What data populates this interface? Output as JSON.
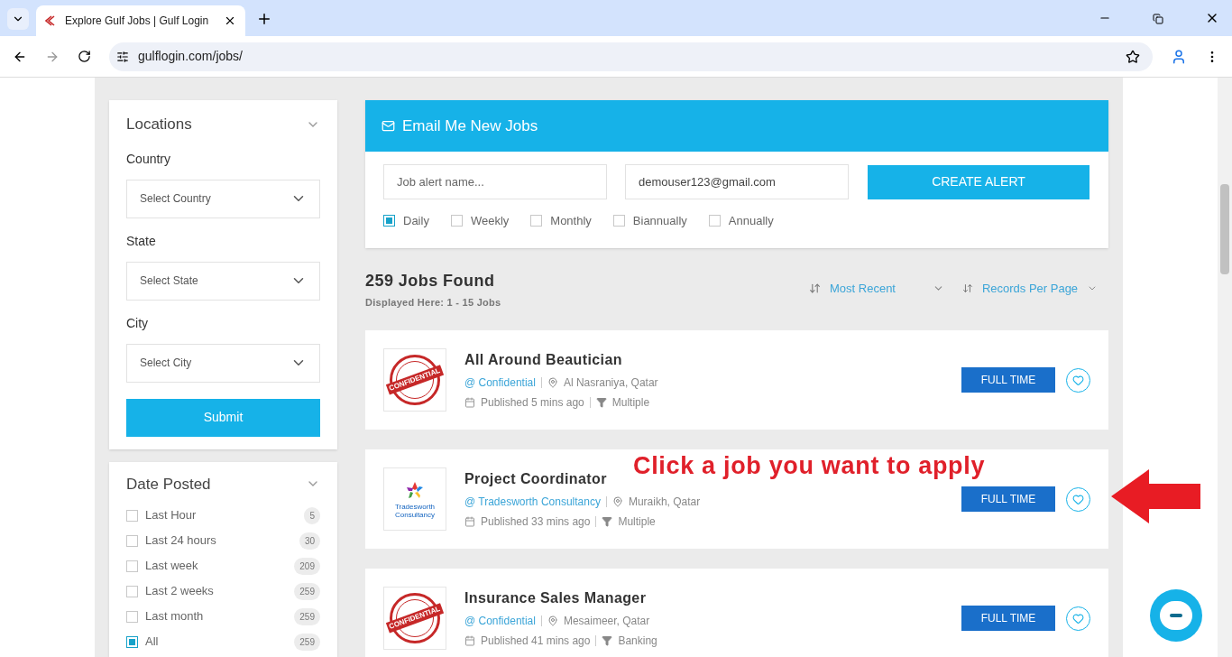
{
  "browser": {
    "tab_title": "Explore Gulf Jobs | Gulf Login",
    "url": "gulflogin.com/jobs/"
  },
  "locations": {
    "title": "Locations",
    "fields": [
      {
        "label": "Country",
        "placeholder": "Select Country"
      },
      {
        "label": "State",
        "placeholder": "Select State"
      },
      {
        "label": "City",
        "placeholder": "Select City"
      }
    ],
    "submit": "Submit"
  },
  "date_posted": {
    "title": "Date Posted",
    "options": [
      {
        "label": "Last Hour",
        "count": "5",
        "checked": false
      },
      {
        "label": "Last 24 hours",
        "count": "30",
        "checked": false
      },
      {
        "label": "Last week",
        "count": "209",
        "checked": false
      },
      {
        "label": "Last 2 weeks",
        "count": "259",
        "checked": false
      },
      {
        "label": "Last month",
        "count": "259",
        "checked": false
      },
      {
        "label": "All",
        "count": "259",
        "checked": true
      }
    ]
  },
  "alert": {
    "title": "Email Me New Jobs",
    "name_placeholder": "Job alert name...",
    "email": "demouser123@gmail.com",
    "button": "CREATE ALERT",
    "frequencies": [
      {
        "label": "Daily",
        "checked": true
      },
      {
        "label": "Weekly",
        "checked": false
      },
      {
        "label": "Monthly",
        "checked": false
      },
      {
        "label": "Biannually",
        "checked": false
      },
      {
        "label": "Annually",
        "checked": false
      }
    ]
  },
  "results": {
    "count": "259 Jobs Found",
    "displayed": "Displayed Here: 1 - 15 Jobs",
    "sort": "Most Recent",
    "per_page": "Records Per Page"
  },
  "jobs": [
    {
      "title": "All Around Beautician",
      "company": "@ Confidential",
      "location": "Al Nasraniya, Qatar",
      "published": "Published 5 mins ago",
      "category": "Multiple",
      "type": "FULL TIME",
      "logo": {
        "kind": "stamp",
        "text": "CONFIDENTIAL"
      }
    },
    {
      "title": "Project Coordinator",
      "company": "@ Tradesworth Consultancy",
      "location": "Muraikh, Qatar",
      "published": "Published 33 mins ago",
      "category": "Multiple",
      "type": "FULL TIME",
      "logo": {
        "kind": "star",
        "text": "Tradesworth Consultancy"
      }
    },
    {
      "title": "Insurance Sales Manager",
      "company": "@ Confidential",
      "location": "Mesaimeer, Qatar",
      "published": "Published 41 mins ago",
      "category": "Banking",
      "type": "FULL TIME",
      "logo": {
        "kind": "stamp",
        "text": "CONFIDENTIAL"
      }
    }
  ],
  "annotation": {
    "text": "Click a job you want to apply"
  }
}
